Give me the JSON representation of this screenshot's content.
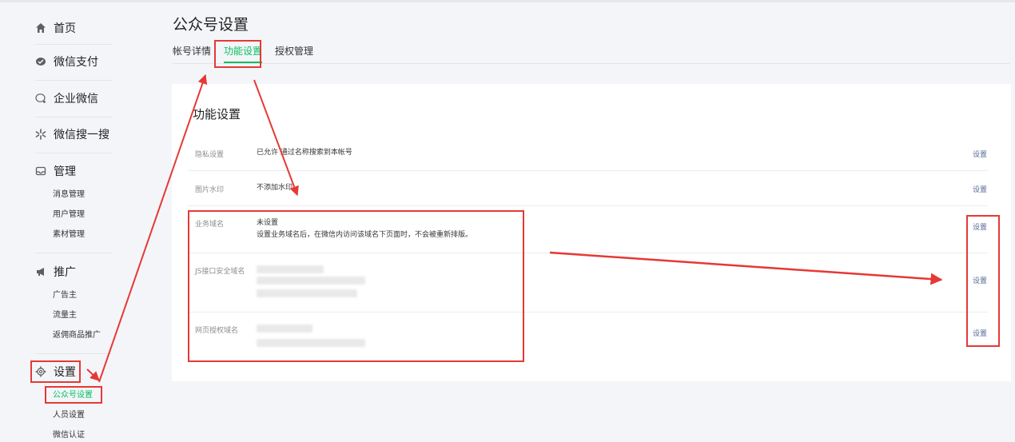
{
  "sidebar": {
    "items": [
      {
        "label": "首页",
        "icon": "home-icon"
      },
      {
        "label": "微信支付",
        "icon": "wechat-pay-icon"
      },
      {
        "label": "企业微信",
        "icon": "work-wechat-icon"
      },
      {
        "label": "微信搜一搜",
        "icon": "search-star-icon"
      },
      {
        "label": "管理",
        "icon": "inbox-icon",
        "children": [
          "消息管理",
          "用户管理",
          "素材管理"
        ]
      },
      {
        "label": "推广",
        "icon": "megaphone-icon",
        "children": [
          "广告主",
          "流量主",
          "返佣商品推广"
        ]
      },
      {
        "label": "设置",
        "icon": "gear-icon",
        "children": [
          "公众号设置",
          "人员设置",
          "微信认证"
        ]
      }
    ],
    "active_child": "公众号设置"
  },
  "page": {
    "title": "公众号设置",
    "tabs": [
      "帐号详情",
      "功能设置",
      "授权管理"
    ],
    "active_tab": "功能设置"
  },
  "card": {
    "title": "功能设置",
    "rows": [
      {
        "label": "隐私设置",
        "value": "已允许 通过名称搜索到本帐号",
        "action": "设置"
      },
      {
        "label": "图片水印",
        "value": "不添加水印",
        "action": "设置"
      },
      {
        "label": "业务域名",
        "value": "未设置",
        "value2": "设置业务域名后，在微信内访问该域名下页面时，不会被重新排版。",
        "action": "设置"
      },
      {
        "label": "JS接口安全域名",
        "value": "",
        "action": "设置"
      },
      {
        "label": "网页授权域名",
        "value": "",
        "action": "设置"
      }
    ]
  },
  "colors": {
    "accent": "#07c160",
    "link": "#576b95",
    "annotation": "#e53935"
  }
}
